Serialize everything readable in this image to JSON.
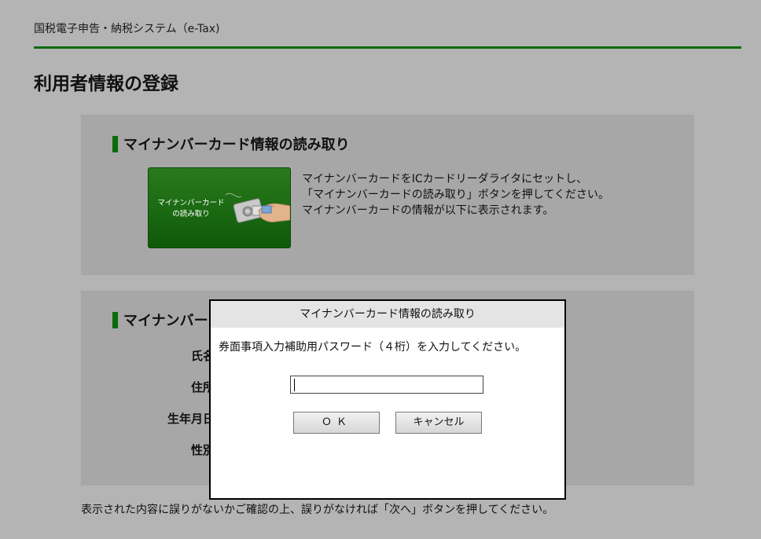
{
  "header": {
    "site_name": "国税電子申告・納税システム（e-Tax)"
  },
  "page": {
    "title": "利用者情報の登録"
  },
  "card_section": {
    "heading": "マイナンバーカード情報の読み取り",
    "button_label_line1": "マイナンバーカード",
    "button_label_line2": "の読み取り",
    "instructions": [
      "マイナンバーカードをICカードリーダライタにセットし、",
      "「マイナンバーカードの読み取り」ボタンを押してください。",
      "マイナンバーカードの情報が以下に表示されます。"
    ]
  },
  "info_section": {
    "heading": "マイナンバー",
    "fields": [
      "氏名",
      "住所",
      "生年月日",
      "性別"
    ]
  },
  "footer": {
    "note": "表示された内容に誤りがないかご確認の上、誤りがなければ「次へ」ボタンを押してください。"
  },
  "dialog": {
    "title": "マイナンバーカード情報の読み取り",
    "message": "券面事項入力補助用パスワード（４桁）を入力してください。",
    "input_value": "",
    "ok_label": "ＯＫ",
    "cancel_label": "キャンセル"
  },
  "colors": {
    "accent_green": "#0c6a0c",
    "background": "#b4b4b4",
    "panel": "#a7a7a7"
  }
}
